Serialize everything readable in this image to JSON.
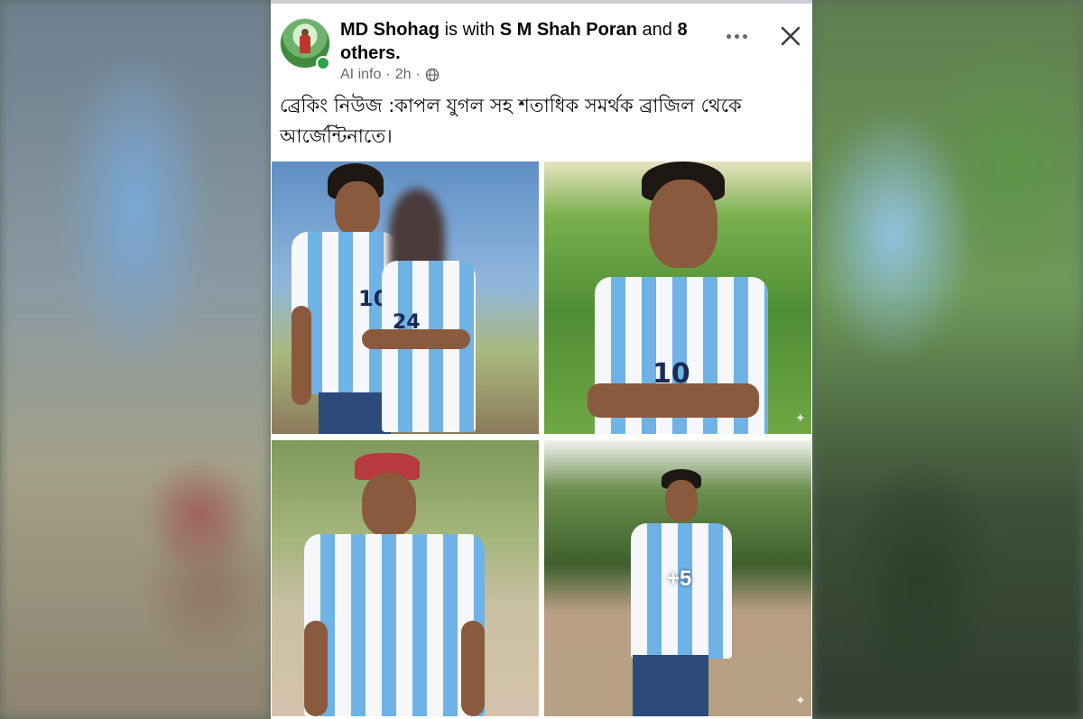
{
  "post": {
    "author": "MD Shohag",
    "with_text": "is with",
    "tagged": "S M Shah Poran",
    "and_text": "and",
    "others_count": "8",
    "others_label": "others.",
    "ai_info": "AI info",
    "dot": "·",
    "time": "2h",
    "audience_icon": "globe-icon",
    "text": "ব্রেকিং নিউজ :কাপল যুগল সহ শতাধিক সমর্থক ব্রাজিল থেকে আর্জেন্টিনাতে।"
  },
  "photos": {
    "more_count": "+5",
    "photo1": {
      "left_number": "10",
      "right_number": "24"
    },
    "photo2": {
      "number": "10"
    }
  },
  "icons": {
    "more": "more-options-icon",
    "close": "close-icon",
    "globe": "globe-icon"
  },
  "colors": {
    "jersey_blue": "#6fb2e6",
    "online": "#31a24c",
    "meta_gray": "#65676b"
  }
}
